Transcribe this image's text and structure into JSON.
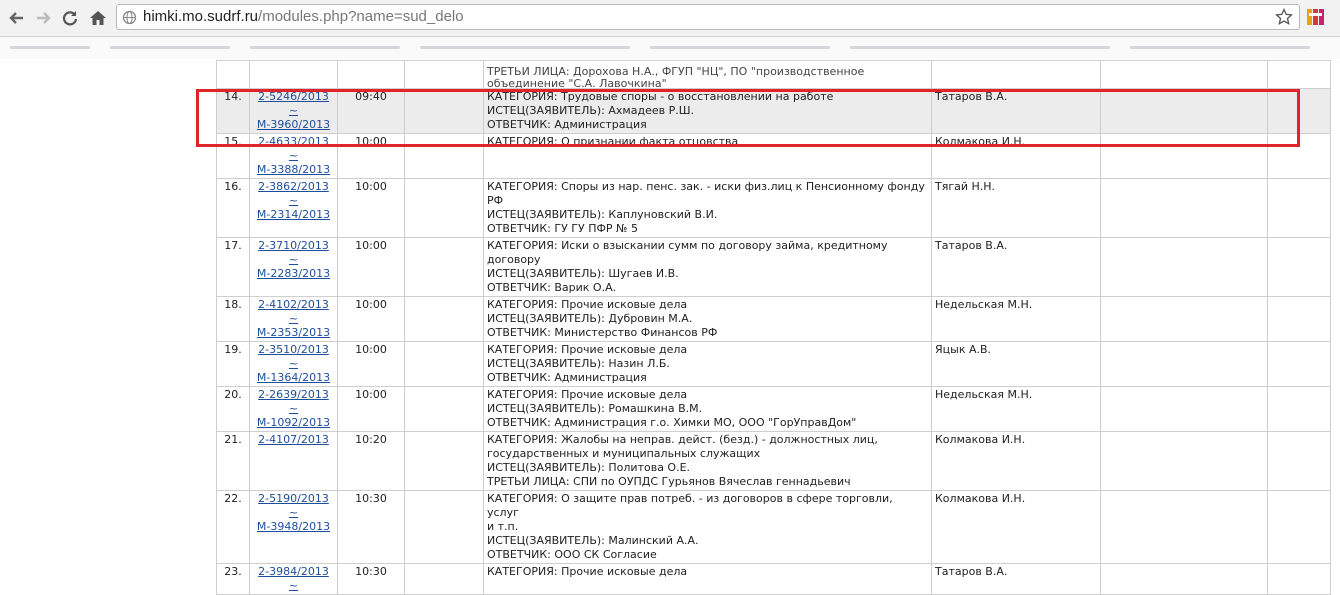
{
  "browser": {
    "url_host": "himki.mo.sudrf.ru",
    "url_path": "/modules.php?name=sud_delo"
  },
  "top_partial": {
    "lines": [
      "ТРЕТЬИ ЛИЦА: Дорохова Н.А., ФГУП \"НЦ\", ПО \"производственное",
      "объединение \"С.А. Лавочкина\""
    ]
  },
  "rows": [
    {
      "num": "14.",
      "case1": "2-5246/2013 ~",
      "case2": "М-3960/2013",
      "time": "09:40",
      "lines": [
        "КАТЕГОРИЯ: Трудовые споры - о восстановлении на работе",
        "ИСТЕЦ(ЗАЯВИТЕЛЬ): Ахмадеев Р.Ш.",
        "ОТВЕТЧИК: Администрация"
      ],
      "judge": "Татаров В.А.",
      "highlight": true
    },
    {
      "num": "15.",
      "case1": "2-4633/2013 ~",
      "case2": "М-3388/2013",
      "time": "10:00",
      "lines": [
        "КАТЕГОРИЯ: О признании факта отцовства"
      ],
      "judge": "Колмакова И.Н.",
      "highlight": false
    },
    {
      "num": "16.",
      "case1": "2-3862/2013 ~",
      "case2": "М-2314/2013",
      "time": "10:00",
      "lines": [
        "КАТЕГОРИЯ: Споры из нар. пенс. зак. - иски физ.лиц к Пенсионному фонду",
        "РФ",
        "ИСТЕЦ(ЗАЯВИТЕЛЬ): Каплуновский В.И.",
        "ОТВЕТЧИК: ГУ ГУ ПФР № 5"
      ],
      "judge": "Тягай Н.Н.",
      "highlight": false
    },
    {
      "num": "17.",
      "case1": "2-3710/2013 ~",
      "case2": "М-2283/2013",
      "time": "10:00",
      "lines": [
        "КАТЕГОРИЯ: Иски о взыскании сумм по договору займа, кредитному",
        "договору",
        "ИСТЕЦ(ЗАЯВИТЕЛЬ): Шугаев И.В.",
        "ОТВЕТЧИК: Варик О.А."
      ],
      "judge": "Татаров В.А.",
      "highlight": false
    },
    {
      "num": "18.",
      "case1": "2-4102/2013 ~",
      "case2": "М-2353/2013",
      "time": "10:00",
      "lines": [
        "КАТЕГОРИЯ: Прочие исковые дела",
        "ИСТЕЦ(ЗАЯВИТЕЛЬ): Дубровин М.А.",
        "ОТВЕТЧИК: Министерство Финансов РФ"
      ],
      "judge": "Недельская М.Н.",
      "highlight": false
    },
    {
      "num": "19.",
      "case1": "2-3510/2013 ~",
      "case2": "М-1364/2013",
      "time": "10:00",
      "lines": [
        "КАТЕГОРИЯ: Прочие исковые дела",
        "ИСТЕЦ(ЗАЯВИТЕЛЬ): Назин Л.Б.",
        "ОТВЕТЧИК: Администрация"
      ],
      "judge": "Яцык А.В.",
      "highlight": false
    },
    {
      "num": "20.",
      "case1": "2-2639/2013 ~",
      "case2": "М-1092/2013",
      "time": "10:00",
      "lines": [
        "КАТЕГОРИЯ: Прочие исковые дела",
        "ИСТЕЦ(ЗАЯВИТЕЛЬ): Ромашкина В.М.",
        "ОТВЕТЧИК: Администрация г.о. Химки МО, ООО \"ГорУправДом\""
      ],
      "judge": "Недельская М.Н.",
      "highlight": false
    },
    {
      "num": "21.",
      "case1": "2-4107/2013",
      "case2": "",
      "time": "10:20",
      "lines": [
        "КАТЕГОРИЯ: Жалобы на неправ. дейст. (безд.) - должностных лиц,",
        "государственных и муниципальных служащих",
        "ИСТЕЦ(ЗАЯВИТЕЛЬ): Политова О.Е.",
        "ТРЕТЬИ ЛИЦА: СПИ по ОУПДС Гурьянов Вячеслав геннадьевич"
      ],
      "judge": "Колмакова И.Н.",
      "highlight": false
    },
    {
      "num": "22.",
      "case1": "2-5190/2013 ~",
      "case2": "М-3948/2013",
      "time": "10:30",
      "lines": [
        "КАТЕГОРИЯ: О защите прав потреб. - из договоров в сфере торговли, услуг",
        "и т.п.",
        "ИСТЕЦ(ЗАЯВИТЕЛЬ): Малинский А.А.",
        "ОТВЕТЧИК: ООО СК Согласие"
      ],
      "judge": "Колмакова И.Н.",
      "highlight": false
    },
    {
      "num": "23.",
      "case1": "2-3984/2013 ~",
      "case2": "",
      "time": "10:30",
      "lines": [
        "КАТЕГОРИЯ: Прочие исковые дела"
      ],
      "judge": "Татаров В.А.",
      "highlight": false
    }
  ]
}
